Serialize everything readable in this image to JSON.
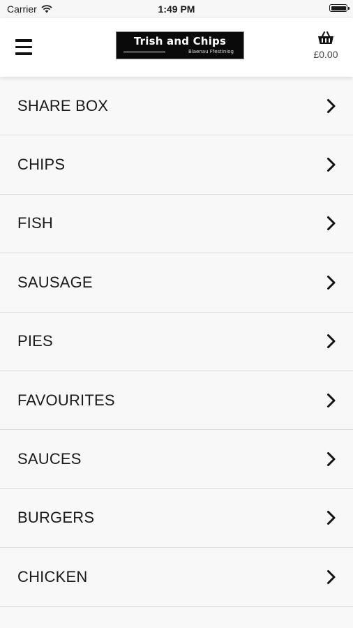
{
  "status_bar": {
    "carrier": "Carrier",
    "time": "1:49 PM"
  },
  "header": {
    "logo_title": "Trish and Chips",
    "logo_subtitle": "Blaenau Ffestiniog",
    "basket_total": "£0.00"
  },
  "categories": [
    {
      "label": "SHARE BOX"
    },
    {
      "label": "CHIPS"
    },
    {
      "label": "FISH"
    },
    {
      "label": "SAUSAGE"
    },
    {
      "label": "PIES"
    },
    {
      "label": "FAVOURITES"
    },
    {
      "label": "SAUCES"
    },
    {
      "label": "BURGERS"
    },
    {
      "label": "CHICKEN"
    }
  ],
  "icons": {
    "menu": "hamburger-menu-icon",
    "basket": "basket-icon",
    "chevron": "chevron-right-icon"
  }
}
